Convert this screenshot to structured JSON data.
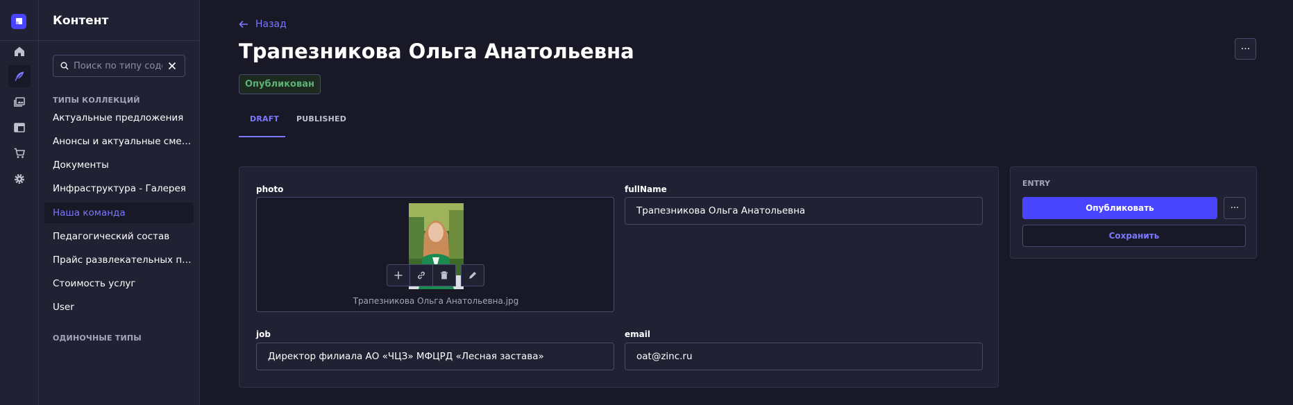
{
  "rail": {
    "items": [
      {
        "icon": "home-icon"
      },
      {
        "icon": "feather-icon",
        "active": true
      },
      {
        "icon": "media-library-icon"
      },
      {
        "icon": "layout-icon"
      },
      {
        "icon": "cart-icon"
      },
      {
        "icon": "gear-icon"
      }
    ]
  },
  "subnav": {
    "title": "Контент",
    "search_placeholder": "Поиск по типу содержимого",
    "collection_types_label": "ТИПЫ КОЛЛЕКЦИЙ",
    "items": [
      {
        "label": "Актуальные предложения"
      },
      {
        "label": "Анонсы и актуальные смены"
      },
      {
        "label": "Документы"
      },
      {
        "label": "Инфраструктура - Галерея"
      },
      {
        "label": "Наша команда",
        "active": true
      },
      {
        "label": "Педагогический состав"
      },
      {
        "label": "Прайс развлекательных п…"
      },
      {
        "label": "Стоимость услуг"
      },
      {
        "label": "User"
      }
    ],
    "single_types_label": "ОДИНОЧНЫЕ ТИПЫ"
  },
  "header": {
    "back_label": "Назад",
    "title": "Трапезникова Ольга Анатольевна",
    "status": "Опубликован",
    "more_label": "···"
  },
  "tabs": [
    {
      "label": "DRAFT",
      "active": true
    },
    {
      "label": "PUBLISHED",
      "active": false
    }
  ],
  "form": {
    "photo": {
      "label": "photo",
      "file_name": "Трапезникова Ольга Анатольевна.jpg"
    },
    "fullName": {
      "label": "fullName",
      "value": "Трапезникова Ольга Анатольевна"
    },
    "job": {
      "label": "job",
      "value": "Директор филиала АО «ЧЦЗ» МФЦРД «Лесная застава»"
    },
    "email": {
      "label": "email",
      "value": "oat@zinc.ru"
    }
  },
  "entry": {
    "label": "ENTRY",
    "publish_label": "Опубликовать",
    "more_label": "···",
    "save_label": "Сохранить"
  },
  "colors": {
    "accent": "#4945ff",
    "accent_text": "#7b79ff",
    "success": "#5cb176",
    "background": "#181826",
    "panel": "#212134"
  }
}
